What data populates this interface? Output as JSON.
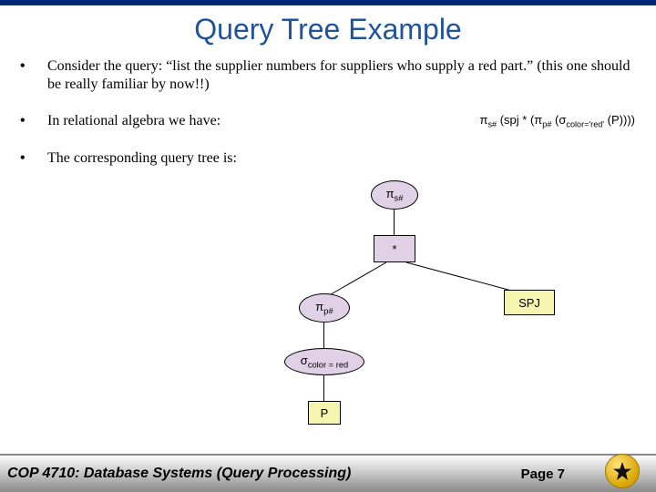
{
  "title": "Query Tree Example",
  "bullets": {
    "b1": "Consider the query: “list the supplier numbers for suppliers who supply a red part.”  (this one should be really familiar by now!!)",
    "b2": "In relational algebra we have:",
    "b3": "The corresponding query tree is:"
  },
  "algebra": {
    "pi1": "π",
    "pi1_sub": "s#",
    "open1": "(spj *",
    "open2": "(",
    "pi2": "π",
    "pi2_sub": "p#",
    "open3": "(",
    "sigma": "σ",
    "sigma_sub": "color='red'",
    "tail": "(P))))"
  },
  "nodes": {
    "root_op": "π",
    "root_sub": "s#",
    "join": "*",
    "left_pi_op": "π",
    "left_pi_sub": "p#",
    "spj": "SPJ",
    "sigma_op": "σ",
    "sigma_sub": "color = red",
    "p": "P"
  },
  "footer": {
    "course": "COP 4710: Database Systems (Query Processing)",
    "page": "Page 7"
  }
}
